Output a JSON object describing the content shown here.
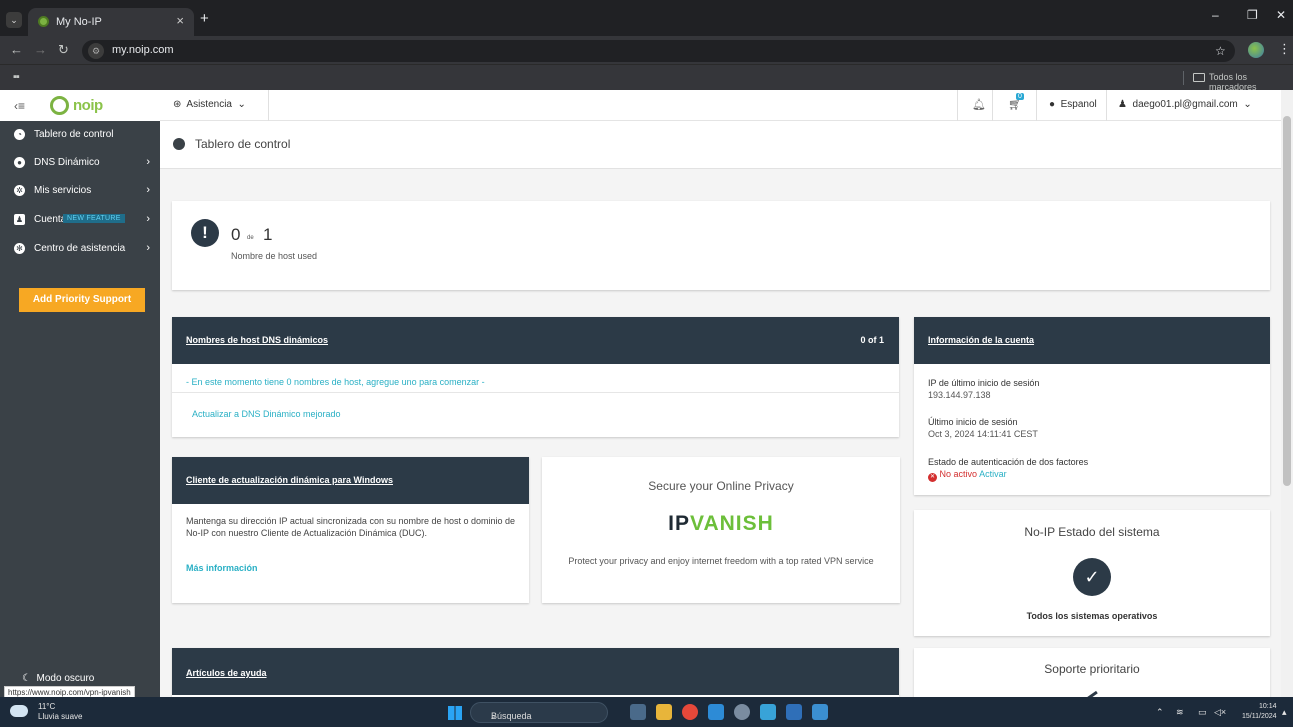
{
  "browser": {
    "tab_title": "My No-IP",
    "tab_close": "×",
    "new_tab": "+",
    "url": "my.noip.com",
    "bookmarks_label": "Todos los marcadores",
    "win_controls": [
      "–",
      "❐",
      "✕"
    ],
    "status_url": "https://www.noip.com/vpn-ipvanish"
  },
  "sidebar": {
    "logo_text": "noip",
    "items": [
      {
        "label": "Tablero de control",
        "icon": "dashboard-icon",
        "chevron": false
      },
      {
        "label": "DNS Dinámico",
        "icon": "globe-icon",
        "chevron": true
      },
      {
        "label": "Mis servicios",
        "icon": "gear-icon",
        "chevron": true
      },
      {
        "label": "Cuenta",
        "icon": "user-icon",
        "chevron": true,
        "badge": "NEW FEATURE"
      },
      {
        "label": "Centro de asistencia",
        "icon": "lifebuoy-icon",
        "chevron": true
      }
    ],
    "priority_button": "Add Priority Support",
    "dark_mode": "Modo oscuro"
  },
  "topbar": {
    "help": "Asistencia",
    "cart_count": "0",
    "language": "Espanol",
    "user_email": "daego01.pl@gmail.com"
  },
  "page": {
    "title": "Tablero de control",
    "hosts": {
      "used": "0",
      "of": "de",
      "total": "1",
      "label": "Nombre de host used"
    },
    "dns_card": {
      "title": "Nombres de host DNS dinámicos",
      "count": "0 of 1",
      "empty_msg": "- En este momento tiene 0 nombres de host, agregue uno para comenzar -",
      "upgrade": "Actualizar a DNS Dinámico mejorado"
    },
    "account_card": {
      "title": "Información de la cuenta",
      "last_ip_label": "IP de último inicio de sesión",
      "last_ip": "193.144.97.138",
      "last_login_label": "Último inicio de sesión",
      "last_login": "Oct 3, 2024 14:11:41 CEST",
      "twofa_label": "Estado de autenticación de dos factores",
      "twofa_status": "No activo",
      "twofa_action": "Activar"
    },
    "duc_card": {
      "title": "Cliente de actualización dinámica para Windows",
      "desc": "Mantenga su dirección IP actual sincronizada con su nombre de host o dominio de No-IP con nuestro Cliente de Actualización Dinámica (DUC).",
      "more": "Más información"
    },
    "ad_card": {
      "title": "Secure your Online Privacy",
      "brand_ip": "IP",
      "brand_vanish": "VANISH",
      "text": "Protect your privacy and enjoy internet freedom with a top rated VPN service"
    },
    "status_card": {
      "title": "No-IP Estado del sistema",
      "text": "Todos los sistemas operativos"
    },
    "articles_card": {
      "title": "Artículos de ayuda"
    },
    "priority_card": {
      "title": "Soporte prioritario"
    }
  },
  "taskbar": {
    "temp": "11°C",
    "weather": "Lluvia suave",
    "search": "Búsqueda",
    "time": "10:14",
    "date": "15/11/2024"
  },
  "colors": {
    "sidebar": "#3a4147",
    "card_header": "#2c3a47",
    "accent_link": "#2ab0c5",
    "priority": "#f7a823",
    "noip_green": "#7cb342",
    "ipvanish_green": "#6cbf3a"
  }
}
